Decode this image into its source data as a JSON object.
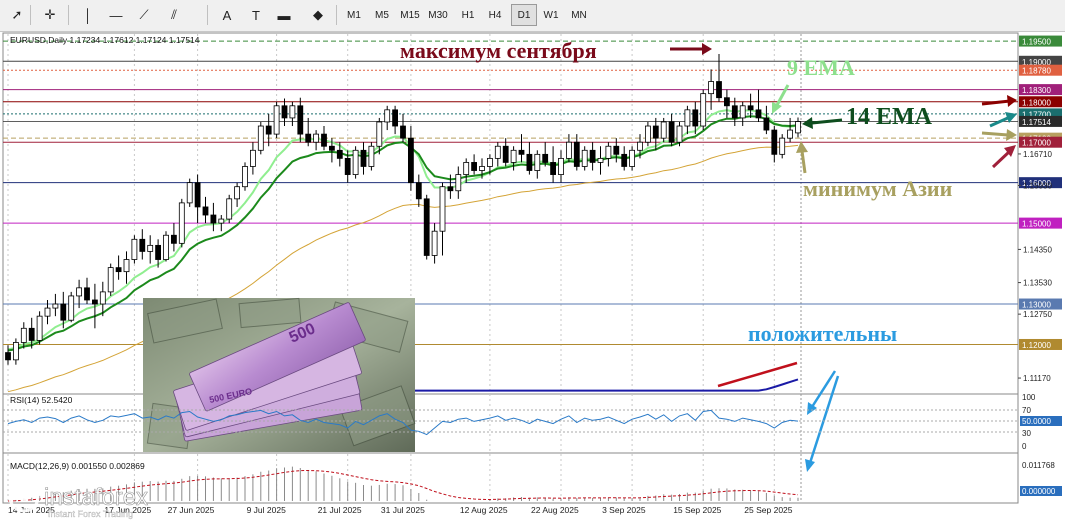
{
  "toolbar": {
    "tools": [
      "cursor-icon",
      "crosshair-icon",
      "vertical-line-icon",
      "horizontal-line-icon",
      "trendline-icon",
      "channel-icon",
      "text-tool-icon",
      "text-label-icon",
      "rectangle-icon",
      "shapes-icon"
    ],
    "timeframes": [
      "M1",
      "M5",
      "M15",
      "M30",
      "H1",
      "H4",
      "D1",
      "W1",
      "MN"
    ],
    "active_timeframe": "D1"
  },
  "chart_info": {
    "symbol_line": "EURUSD,Daily  1.17234 1.17612 1.17124 1.17514"
  },
  "annotations": {
    "sep_high": "максимум сентября",
    "ema9": "9 EMA",
    "ema14": "14 EMA",
    "asia_low": "минимум Азии",
    "positive": "положительны"
  },
  "rsi_panel": {
    "label": "RSI(14) 52.5420",
    "levels": [
      "100",
      "70",
      "50.0000",
      "30",
      "0"
    ]
  },
  "macd_panel": {
    "label": "MACD(12,26,9) 0.001550 0.002869",
    "top_value": "0.011768",
    "bottom_value": "0.000000"
  },
  "watermark": {
    "brand": "instaforex",
    "tagline": "Instant Forex Trading"
  },
  "colors": {
    "bull_candle": "#ffffff",
    "bear_candle": "#000000",
    "ema9": "#90ee90",
    "ema14": "#1c8a1c",
    "ema_slow": "#d4a437",
    "ema_long": "#1a1aa6",
    "annotation_dark": "#7a0a1a",
    "annotation_green_light": "#8de08d",
    "annotation_green_dark": "#0e4d1e",
    "annotation_olive": "#a8a060",
    "annotation_blue": "#2b9be0",
    "rsi_line": "#2a7ac8",
    "macd_signal": "#c0101c"
  },
  "chart_data": {
    "type": "line",
    "title": "EURUSD,Daily",
    "ylim": [
      1.1085,
      1.1965
    ],
    "price_levels": [
      {
        "label": "1.19500",
        "value": 1.195,
        "color": "#3a8a3a",
        "style": "dashed"
      },
      {
        "label": "1.19000",
        "value": 1.19,
        "color": "#444444",
        "style": "solid"
      },
      {
        "label": "1.18780",
        "value": 1.1878,
        "color": "#e06040",
        "style": "dotted"
      },
      {
        "label": "1.18300",
        "value": 1.183,
        "color": "#a0207a",
        "style": "solid"
      },
      {
        "label": "1.18000",
        "value": 1.18,
        "color": "#8b0000",
        "style": "solid"
      },
      {
        "label": "1.17700",
        "value": 1.177,
        "color": "#1a6e6e",
        "style": "dotted"
      },
      {
        "label": "1.17514",
        "value": 1.17514,
        "color": "#2a2a2a",
        "style": "current"
      },
      {
        "label": "1.17100",
        "value": 1.171,
        "color": "#b8a060",
        "style": "dashed"
      },
      {
        "label": "1.17000",
        "value": 1.17,
        "color": "#a0203a",
        "style": "solid"
      },
      {
        "label": "1.16000",
        "value": 1.16,
        "color": "#20307a",
        "style": "solid"
      },
      {
        "label": "1.15000",
        "value": 1.15,
        "color": "#c020c0",
        "style": "solid"
      },
      {
        "label": "1.13000",
        "value": 1.13,
        "color": "#5a7ab0",
        "style": "solid"
      },
      {
        "label": "1.12000",
        "value": 1.12,
        "color": "#b08a30",
        "style": "solid"
      }
    ],
    "y_ticks": [
      "1.16710",
      "1.15930",
      "1.14350",
      "1.13530",
      "1.12750",
      "1.11170"
    ],
    "y_tick_values": [
      1.1671,
      1.1593,
      1.1435,
      1.1353,
      1.1275,
      1.1117
    ],
    "x_tick_labels": [
      "14 Jun 2025",
      "17 Jun 2025",
      "27 Jun 2025",
      "9 Jul 2025",
      "21 Jul 2025",
      "31 Jul 2025",
      "12 Aug 2025",
      "22 Aug 2025",
      "3 Sep 2025",
      "15 Sep 2025",
      "25 Sep 2025"
    ],
    "x_tick_index": [
      0,
      16,
      24,
      34,
      43,
      51,
      61,
      70,
      79,
      88,
      97
    ],
    "ohlc": [
      [
        1.118,
        1.1198,
        1.115,
        1.1162
      ],
      [
        1.1162,
        1.1215,
        1.115,
        1.1205
      ],
      [
        1.1205,
        1.1255,
        1.119,
        1.124
      ],
      [
        1.124,
        1.1266,
        1.119,
        1.121
      ],
      [
        1.121,
        1.1282,
        1.12,
        1.127
      ],
      [
        1.127,
        1.131,
        1.125,
        1.129
      ],
      [
        1.129,
        1.1325,
        1.127,
        1.13
      ],
      [
        1.13,
        1.133,
        1.124,
        1.126
      ],
      [
        1.126,
        1.133,
        1.1255,
        1.132
      ],
      [
        1.132,
        1.136,
        1.129,
        1.134
      ],
      [
        1.134,
        1.1365,
        1.13,
        1.131
      ],
      [
        1.131,
        1.135,
        1.124,
        1.13
      ],
      [
        1.13,
        1.1355,
        1.127,
        1.133
      ],
      [
        1.133,
        1.14,
        1.132,
        1.139
      ],
      [
        1.139,
        1.142,
        1.136,
        1.138
      ],
      [
        1.138,
        1.143,
        1.135,
        1.141
      ],
      [
        1.141,
        1.147,
        1.14,
        1.146
      ],
      [
        1.146,
        1.1485,
        1.141,
        1.143
      ],
      [
        1.143,
        1.147,
        1.14,
        1.1445
      ],
      [
        1.1445,
        1.146,
        1.139,
        1.141
      ],
      [
        1.141,
        1.148,
        1.1405,
        1.147
      ],
      [
        1.147,
        1.15,
        1.143,
        1.145
      ],
      [
        1.145,
        1.156,
        1.144,
        1.155
      ],
      [
        1.155,
        1.161,
        1.154,
        1.16
      ],
      [
        1.16,
        1.162,
        1.15,
        1.154
      ],
      [
        1.154,
        1.1565,
        1.15,
        1.152
      ],
      [
        1.152,
        1.155,
        1.148,
        1.15
      ],
      [
        1.15,
        1.152,
        1.148,
        1.151
      ],
      [
        1.151,
        1.157,
        1.15,
        1.156
      ],
      [
        1.156,
        1.16,
        1.154,
        1.159
      ],
      [
        1.159,
        1.165,
        1.158,
        1.164
      ],
      [
        1.164,
        1.17,
        1.162,
        1.168
      ],
      [
        1.168,
        1.175,
        1.167,
        1.174
      ],
      [
        1.174,
        1.177,
        1.169,
        1.172
      ],
      [
        1.172,
        1.18,
        1.171,
        1.179
      ],
      [
        1.179,
        1.1808,
        1.174,
        1.176
      ],
      [
        1.176,
        1.18,
        1.174,
        1.179
      ],
      [
        1.179,
        1.181,
        1.17,
        1.172
      ],
      [
        1.172,
        1.176,
        1.169,
        1.17
      ],
      [
        1.17,
        1.173,
        1.168,
        1.172
      ],
      [
        1.172,
        1.174,
        1.168,
        1.169
      ],
      [
        1.169,
        1.171,
        1.165,
        1.168
      ],
      [
        1.168,
        1.17,
        1.164,
        1.166
      ],
      [
        1.166,
        1.168,
        1.16,
        1.162
      ],
      [
        1.162,
        1.169,
        1.161,
        1.168
      ],
      [
        1.168,
        1.17,
        1.162,
        1.164
      ],
      [
        1.164,
        1.17,
        1.163,
        1.169
      ],
      [
        1.169,
        1.176,
        1.167,
        1.175
      ],
      [
        1.175,
        1.179,
        1.173,
        1.178
      ],
      [
        1.178,
        1.179,
        1.172,
        1.174
      ],
      [
        1.174,
        1.177,
        1.17,
        1.171
      ],
      [
        1.171,
        1.174,
        1.158,
        1.16
      ],
      [
        1.16,
        1.162,
        1.154,
        1.156
      ],
      [
        1.156,
        1.157,
        1.141,
        1.142
      ],
      [
        1.142,
        1.15,
        1.14,
        1.148
      ],
      [
        1.148,
        1.16,
        1.142,
        1.159
      ],
      [
        1.159,
        1.162,
        1.156,
        1.158
      ],
      [
        1.158,
        1.164,
        1.156,
        1.162
      ],
      [
        1.162,
        1.166,
        1.16,
        1.165
      ],
      [
        1.165,
        1.167,
        1.162,
        1.163
      ],
      [
        1.163,
        1.166,
        1.161,
        1.164
      ],
      [
        1.164,
        1.167,
        1.162,
        1.166
      ],
      [
        1.166,
        1.17,
        1.164,
        1.169
      ],
      [
        1.169,
        1.171,
        1.164,
        1.165
      ],
      [
        1.165,
        1.169,
        1.163,
        1.168
      ],
      [
        1.168,
        1.172,
        1.165,
        1.167
      ],
      [
        1.167,
        1.17,
        1.162,
        1.163
      ],
      [
        1.163,
        1.168,
        1.161,
        1.167
      ],
      [
        1.167,
        1.17,
        1.164,
        1.165
      ],
      [
        1.165,
        1.169,
        1.16,
        1.162
      ],
      [
        1.162,
        1.168,
        1.16,
        1.166
      ],
      [
        1.166,
        1.172,
        1.165,
        1.17
      ],
      [
        1.17,
        1.172,
        1.163,
        1.164
      ],
      [
        1.164,
        1.169,
        1.163,
        1.168
      ],
      [
        1.168,
        1.17,
        1.163,
        1.165
      ],
      [
        1.165,
        1.169,
        1.162,
        1.166
      ],
      [
        1.166,
        1.17,
        1.164,
        1.169
      ],
      [
        1.169,
        1.171,
        1.165,
        1.167
      ],
      [
        1.167,
        1.169,
        1.163,
        1.164
      ],
      [
        1.164,
        1.169,
        1.163,
        1.168
      ],
      [
        1.168,
        1.172,
        1.166,
        1.17
      ],
      [
        1.17,
        1.175,
        1.169,
        1.174
      ],
      [
        1.174,
        1.176,
        1.168,
        1.171
      ],
      [
        1.171,
        1.176,
        1.17,
        1.175
      ],
      [
        1.175,
        1.177,
        1.169,
        1.17
      ],
      [
        1.17,
        1.175,
        1.169,
        1.174
      ],
      [
        1.174,
        1.179,
        1.172,
        1.178
      ],
      [
        1.178,
        1.18,
        1.172,
        1.174
      ],
      [
        1.174,
        1.183,
        1.173,
        1.182
      ],
      [
        1.182,
        1.188,
        1.178,
        1.185
      ],
      [
        1.185,
        1.1918,
        1.18,
        1.181
      ],
      [
        1.181,
        1.183,
        1.176,
        1.179
      ],
      [
        1.179,
        1.181,
        1.174,
        1.176
      ],
      [
        1.176,
        1.18,
        1.174,
        1.179
      ],
      [
        1.179,
        1.182,
        1.176,
        1.178
      ],
      [
        1.178,
        1.183,
        1.175,
        1.176
      ],
      [
        1.176,
        1.179,
        1.172,
        1.173
      ],
      [
        1.173,
        1.174,
        1.165,
        1.167
      ],
      [
        1.167,
        1.172,
        1.166,
        1.171
      ],
      [
        1.171,
        1.176,
        1.17,
        1.173
      ],
      [
        1.1723,
        1.1761,
        1.1712,
        1.1751
      ]
    ],
    "series": [
      {
        "name": "9 EMA",
        "values": [
          1.1188,
          1.1192,
          1.1201,
          1.1205,
          1.1213,
          1.1228,
          1.1243,
          1.1252,
          1.1262,
          1.1278,
          1.1289,
          1.1294,
          1.1302,
          1.1319,
          1.1331,
          1.1345,
          1.1365,
          1.1377,
          1.1391,
          1.1398,
          1.141,
          1.1419,
          1.1446,
          1.1477,
          1.149,
          1.1496,
          1.1497,
          1.15,
          1.1512,
          1.1528,
          1.155,
          1.1576,
          1.1609,
          1.1631,
          1.1663,
          1.1682,
          1.1704,
          1.1707,
          1.1706,
          1.1709,
          1.1705,
          1.17,
          1.1692,
          1.1677,
          1.1678,
          1.1671,
          1.1675,
          1.169,
          1.1708,
          1.1714,
          1.1713,
          1.169,
          1.1664,
          1.1615,
          1.1588,
          1.1588,
          1.1587,
          1.1593,
          1.1605,
          1.161,
          1.1616,
          1.1625,
          1.1638,
          1.164,
          1.1648,
          1.1652,
          1.1648,
          1.1652,
          1.1652,
          1.1646,
          1.1649,
          1.1659,
          1.1655,
          1.166,
          1.1658,
          1.1658,
          1.1665,
          1.1666,
          1.1661,
          1.1665,
          1.1672,
          1.1686,
          1.169,
          1.1702,
          1.1702,
          1.171,
          1.1724,
          1.1727,
          1.1746,
          1.1767,
          1.1776,
          1.1779,
          1.1775,
          1.1778,
          1.1779,
          1.1775,
          1.1766,
          1.1747,
          1.174,
          1.1738,
          1.1741
        ]
      },
      {
        "name": "14 EMA",
        "values": [
          1.1185,
          1.1188,
          1.1195,
          1.1198,
          1.1207,
          1.1218,
          1.1229,
          1.1234,
          1.1245,
          1.1257,
          1.1264,
          1.127,
          1.1278,
          1.1292,
          1.1303,
          1.1315,
          1.1334,
          1.1346,
          1.1359,
          1.1366,
          1.1378,
          1.1387,
          1.1409,
          1.1435,
          1.1449,
          1.1458,
          1.1464,
          1.1469,
          1.1481,
          1.1495,
          1.1514,
          1.1536,
          1.1563,
          1.1584,
          1.1611,
          1.1631,
          1.1652,
          1.1661,
          1.1666,
          1.1673,
          1.1675,
          1.1676,
          1.1674,
          1.1667,
          1.1669,
          1.1665,
          1.1668,
          1.1679,
          1.1692,
          1.1698,
          1.17,
          1.1687,
          1.167,
          1.1637,
          1.1616,
          1.1612,
          1.1608,
          1.161,
          1.1615,
          1.1617,
          1.162,
          1.1626,
          1.1635,
          1.1637,
          1.1642,
          1.1645,
          1.1643,
          1.1646,
          1.1647,
          1.1643,
          1.1646,
          1.1653,
          1.1651,
          1.1655,
          1.1655,
          1.1656,
          1.1661,
          1.1663,
          1.166,
          1.1663,
          1.1668,
          1.1678,
          1.1682,
          1.1691,
          1.1692,
          1.1699,
          1.171,
          1.1714,
          1.1728,
          1.1744,
          1.1753,
          1.1758,
          1.1758,
          1.1762,
          1.1764,
          1.1763,
          1.1757,
          1.1745,
          1.1741,
          1.174,
          1.1742
        ]
      }
    ],
    "rsi": [
      48,
      52,
      55,
      50,
      58,
      60,
      57,
      50,
      58,
      62,
      55,
      50,
      54,
      62,
      60,
      63,
      66,
      58,
      60,
      55,
      62,
      58,
      68,
      70,
      60,
      56,
      52,
      55,
      62,
      64,
      68,
      70,
      72,
      66,
      70,
      62,
      64,
      54,
      50,
      56,
      50,
      48,
      46,
      40,
      52,
      46,
      54,
      62,
      66,
      56,
      50,
      36,
      34,
      28,
      40,
      52,
      50,
      56,
      58,
      52,
      55,
      58,
      62,
      54,
      58,
      54,
      48,
      56,
      52,
      48,
      56,
      62,
      50,
      58,
      54,
      56,
      60,
      54,
      48,
      56,
      60,
      65,
      56,
      64,
      52,
      62,
      66,
      54,
      70,
      72,
      58,
      56,
      52,
      58,
      55,
      52,
      48,
      40,
      50,
      54,
      52.5
    ]
  }
}
